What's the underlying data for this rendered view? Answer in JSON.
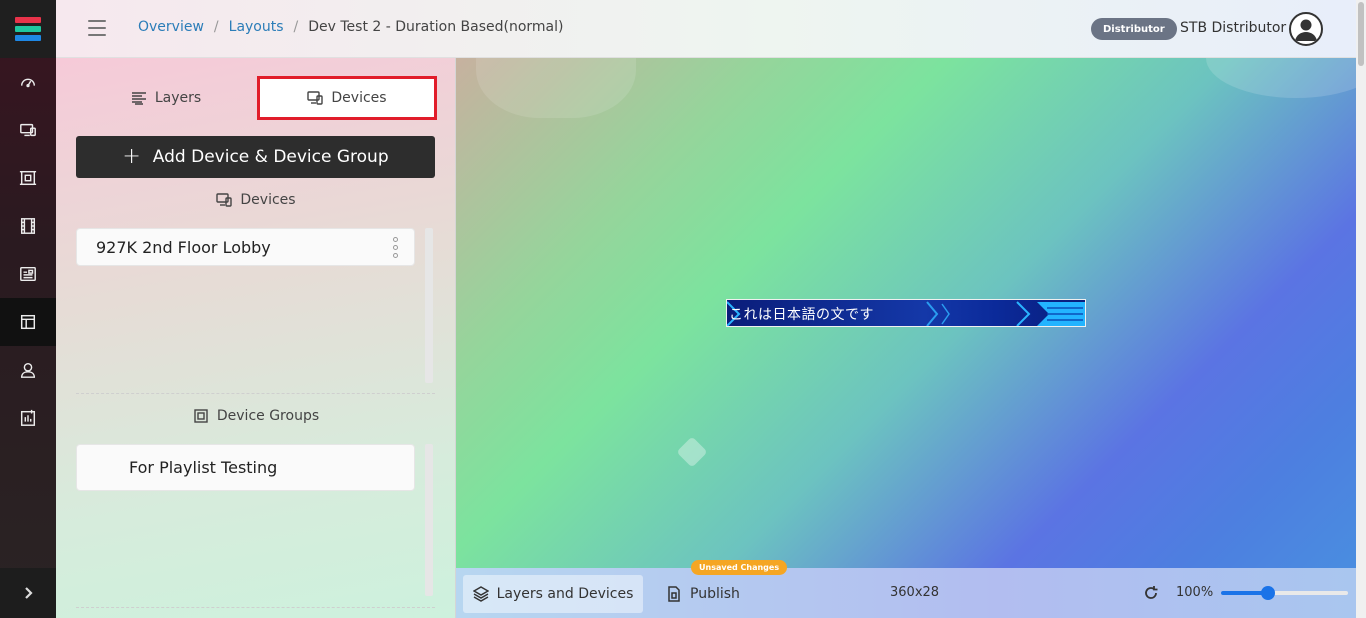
{
  "brand_colors": {
    "logo_red": "#e8334a",
    "logo_green": "#1fc7a0",
    "logo_blue": "#1e88e5",
    "accent_link": "#2b7db8",
    "highlight_border": "#e11d2a",
    "unsaved_badge": "#f5a623"
  },
  "sidebar": {
    "items": [
      {
        "icon": "dashboard-icon"
      },
      {
        "icon": "devices-icon"
      },
      {
        "icon": "device-group-icon"
      },
      {
        "icon": "film-icon"
      },
      {
        "icon": "playlist-icon"
      },
      {
        "icon": "layout-icon",
        "active": true
      },
      {
        "icon": "users-icon"
      },
      {
        "icon": "reports-icon"
      }
    ],
    "expand_icon": "chevron-right-icon"
  },
  "header": {
    "breadcrumb": [
      {
        "label": "Overview",
        "link": true
      },
      {
        "label": "Layouts",
        "link": true
      },
      {
        "label": "Dev Test 2 - Duration Based(normal)",
        "link": false
      }
    ],
    "role_badge": "Distributor",
    "user_name": "STB Distributor"
  },
  "panel": {
    "tabs": {
      "layers": "Layers",
      "devices": "Devices"
    },
    "add_button": "Add Device & Device Group",
    "devices_title": "Devices",
    "devices": [
      "927K 2nd Floor Lobby"
    ],
    "groups_title": "Device Groups",
    "groups": [
      "For Playlist Testing"
    ]
  },
  "canvas": {
    "ticker_text": "これは日本語の文です"
  },
  "toolbar": {
    "unsaved": "Unsaved Changes",
    "layers_and_devices": "Layers and Devices",
    "publish": "Publish",
    "resolution": "360x28",
    "zoom": "100%",
    "zoom_level": 0.35
  }
}
